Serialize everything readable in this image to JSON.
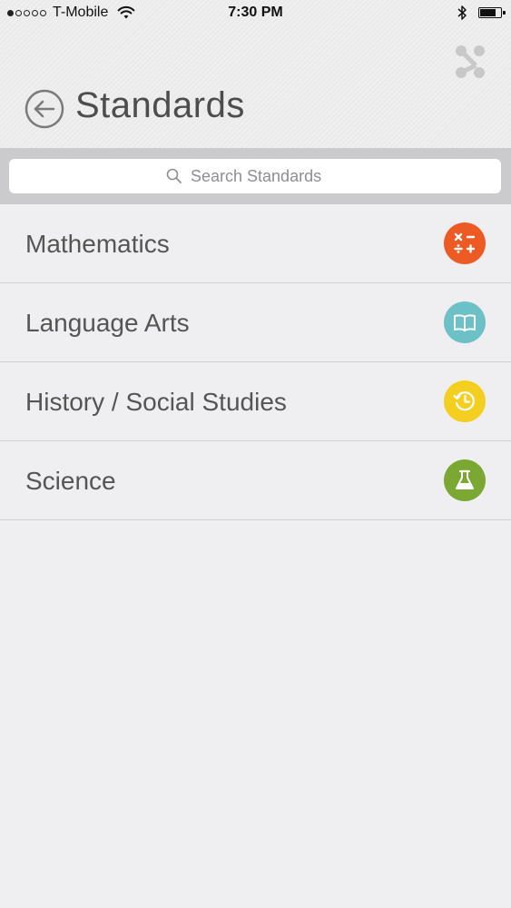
{
  "status_bar": {
    "carrier": "T-Mobile",
    "time": "7:30 PM",
    "signal_dots": [
      true,
      false,
      false,
      false,
      false
    ]
  },
  "header": {
    "title": "Standards",
    "back_icon": "back-arrow-icon",
    "share_icon": "share-icon"
  },
  "search": {
    "placeholder": "Search Standards",
    "value": ""
  },
  "subjects": [
    {
      "label": "Mathematics",
      "icon": "math-operators-icon",
      "color": "#ee5a24"
    },
    {
      "label": "Language Arts",
      "icon": "open-book-icon",
      "color": "#6cc1c6"
    },
    {
      "label": "History / Social Studies",
      "icon": "history-clock-icon",
      "color": "#f5cf1f"
    },
    {
      "label": "Science",
      "icon": "flask-icon",
      "color": "#7aa832"
    }
  ],
  "colors": {
    "header_background": "#ebebeb",
    "page_background": "#efeff1",
    "search_bar_background": "#cbcbcd"
  }
}
